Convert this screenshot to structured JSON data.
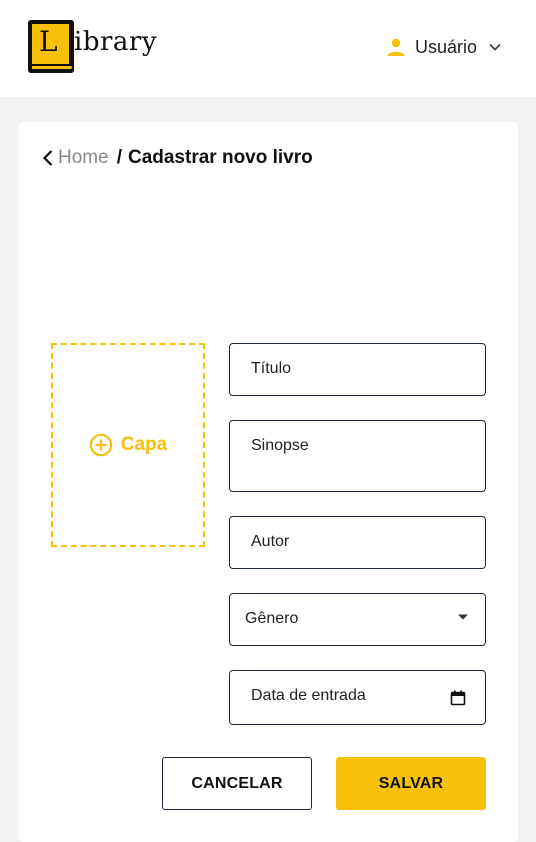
{
  "header": {
    "logo_letter": "L",
    "logo_text": "ibrary",
    "user_label": "Usuário",
    "user_icon": "person-icon",
    "chevron_icon": "chevron-down-icon"
  },
  "breadcrumb": {
    "home": "Home",
    "separator": "/",
    "current": "Cadastrar novo livro"
  },
  "cover": {
    "label": "Capa",
    "icon": "add-circle-icon"
  },
  "form": {
    "titulo_placeholder": "Título",
    "sinopse_placeholder": "Sinopse",
    "autor_placeholder": "Autor",
    "genero_placeholder": "Gênero",
    "data_placeholder": "Data de entrada"
  },
  "actions": {
    "cancel_label": "CANCELAR",
    "save_label": "SALVAR"
  },
  "colors": {
    "accent": "#f7c10a",
    "border": "#1e2a3d",
    "background": "#f3f3f3"
  }
}
